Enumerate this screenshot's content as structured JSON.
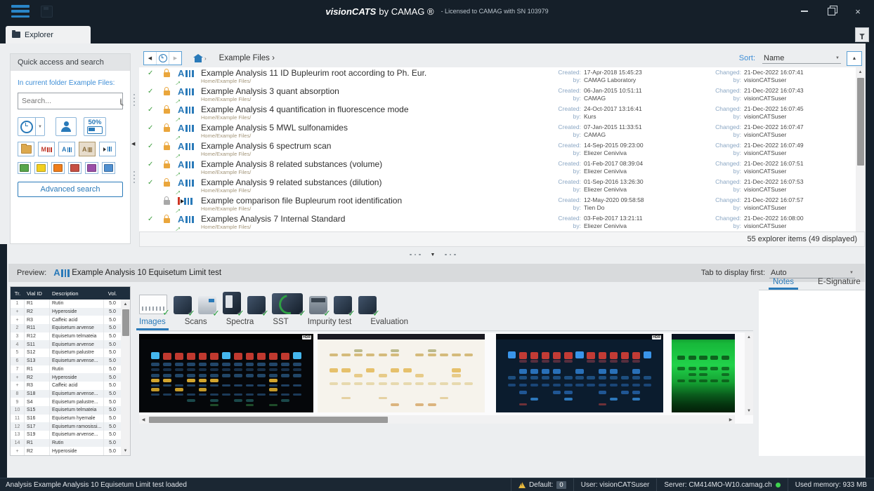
{
  "titlebar": {
    "product": "visionCATS",
    "by": "by CAMAG ®",
    "license": "-  Licensed to CAMAG with SN 103979",
    "minimize": "–",
    "restore": "",
    "close": "×"
  },
  "tabbar": {
    "explorer": "Explorer"
  },
  "quick": {
    "header": "Quick access and search",
    "context": "In current folder Example Files:",
    "search_placeholder": "Search...",
    "zoom": "50%",
    "advanced": "Advanced search",
    "letters": {
      "method": "M",
      "analysis": "A",
      "archive": "A"
    },
    "colors": [
      "#57a64a",
      "#f2cf1f",
      "#ef7d1a",
      "#c64f43",
      "#9b4fa8",
      "#4f8fd0"
    ]
  },
  "browser": {
    "breadcrumb": "Example Files ›",
    "sort_label": "Sort:",
    "sort_value": "Name",
    "labels": {
      "created": "Created:",
      "changed": "Changed:",
      "by": "by:"
    },
    "count": "55 explorer items (49 displayed)",
    "items": [
      {
        "title": "Example Analysis 11 ID Bupleurim root according to Ph. Eur.",
        "path": "Home/Example Files/",
        "created": "17-Apr-2018 15:45:23",
        "created_by": "CAMAG Laboratory",
        "changed": "21-Dec-2022 16:07:41",
        "changed_by": "visionCATSuser",
        "checked": true,
        "lock": "orange",
        "icon": "analysis"
      },
      {
        "title": "Example Analysis 3 quant absorption",
        "path": "Home/Example Files/",
        "created": "06-Jan-2015 10:51:11",
        "created_by": "CAMAG",
        "changed": "21-Dec-2022 16:07:43",
        "changed_by": "visionCATSuser",
        "checked": true,
        "lock": "orange",
        "icon": "analysis"
      },
      {
        "title": "Example Analysis 4 quantification in fluorescence mode",
        "path": "Home/Example Files/",
        "created": "24-Oct-2017 13:16:41",
        "created_by": "Kurs",
        "changed": "21-Dec-2022 16:07:45",
        "changed_by": "visionCATSuser",
        "checked": true,
        "lock": "orange",
        "icon": "analysis"
      },
      {
        "title": "Example Analysis 5 MWL sulfonamides",
        "path": "Home/Example Files/",
        "created": "07-Jan-2015 11:33:51",
        "created_by": "CAMAG",
        "changed": "21-Dec-2022 16:07:47",
        "changed_by": "visionCATSuser",
        "checked": true,
        "lock": "orange",
        "icon": "analysis"
      },
      {
        "title": "Example Analysis 6 spectrum scan",
        "path": "Home/Example Files/",
        "created": "14-Sep-2015 09:23:00",
        "created_by": "Eliezer Ceniviva",
        "changed": "21-Dec-2022 16:07:49",
        "changed_by": "visionCATSuser",
        "checked": true,
        "lock": "orange",
        "icon": "analysis"
      },
      {
        "title": "Example Analysis 8 related substances (volume)",
        "path": "Home/Example Files/",
        "created": "01-Feb-2017 08:39:04",
        "created_by": "Eliezer Ceniviva",
        "changed": "21-Dec-2022 16:07:51",
        "changed_by": "visionCATSuser",
        "checked": true,
        "lock": "orange",
        "icon": "analysis"
      },
      {
        "title": "Example Analysis 9 related substances (dilution)",
        "path": "Home/Example Files/",
        "created": "01-Sep-2016 13:26:30",
        "created_by": "Eliezer Ceniviva",
        "changed": "21-Dec-2022 16:07:53",
        "changed_by": "visionCATSuser",
        "checked": true,
        "lock": "orange",
        "icon": "analysis"
      },
      {
        "title": "Example comparison file Bupleurum root identification",
        "path": "Home/Example Files/",
        "created": "12-May-2020 09:58:58",
        "created_by": "Tien Do",
        "changed": "21-Dec-2022 16:07:57",
        "changed_by": "visionCATSuser",
        "checked": false,
        "lock": "gray",
        "icon": "comparison"
      },
      {
        "title": "Examples Analysis 7 Internal Standard",
        "path": "Home/Example Files/",
        "created": "03-Feb-2017 13:21:11",
        "created_by": "Eliezer Ceniviva",
        "changed": "21-Dec-2022 16:08:00",
        "changed_by": "visionCATSuser",
        "checked": true,
        "lock": "orange",
        "icon": "analysis"
      }
    ]
  },
  "preview": {
    "label": "Preview:",
    "title": "Example Analysis 10 Equisetum Limit test",
    "tab_first_label": "Tab to display first:",
    "tab_first_value": "Auto",
    "table": {
      "headers": [
        "Tr.",
        "Vial ID",
        "Description",
        "Vol."
      ],
      "rows": [
        [
          "1",
          "R1",
          "Rutin",
          "5.0"
        ],
        [
          "+",
          "R2",
          "Hyperoside",
          "5.0"
        ],
        [
          "+",
          "R3",
          "Caffeic acid",
          "5.0"
        ],
        [
          "2",
          "R11",
          "Equisetum arvense",
          "5.0"
        ],
        [
          "3",
          "R12",
          "Equisetum telmateia",
          "5.0"
        ],
        [
          "4",
          "S11",
          "Equisetum arvense",
          "5.0"
        ],
        [
          "5",
          "S12",
          "Equisetum palustre",
          "5.0"
        ],
        [
          "6",
          "S13",
          "Equisetum arvense...",
          "5.0"
        ],
        [
          "7",
          "R1",
          "Rutin",
          "5.0"
        ],
        [
          "+",
          "R2",
          "Hyperoside",
          "5.0"
        ],
        [
          "+",
          "R3",
          "Caffeic acid",
          "5.0"
        ],
        [
          "8",
          "S18",
          "Equisetum arvense...",
          "5.0"
        ],
        [
          "9",
          "S4",
          "Equisetum palustre...",
          "5.0"
        ],
        [
          "10",
          "S15",
          "Equisetum telmateia",
          "5.0"
        ],
        [
          "11",
          "S16",
          "Equisetum hyemale",
          "5.0"
        ],
        [
          "12",
          "S17",
          "Equisetum ramosissi...",
          "5.0"
        ],
        [
          "13",
          "S19",
          "Equisetum arvense...",
          "5.0"
        ],
        [
          "14",
          "R1",
          "Rutin",
          "5.0"
        ],
        [
          "+",
          "R2",
          "Hyperoside",
          "5.0"
        ]
      ]
    },
    "instruments": [
      "plate-layout",
      "sample-application",
      "plate-heater",
      "development-tower",
      "derivatizer",
      "visualizer",
      "immersion-device",
      "scanner",
      "documentation"
    ],
    "tabs": [
      "Images",
      "Scans",
      "Spectra",
      "SST",
      "Impurity test",
      "Evaluation"
    ],
    "active_tab": "Images",
    "side_tabs": [
      "Notes",
      "E-Signature"
    ],
    "active_side_tab": "Notes",
    "thumbnails": [
      {
        "name": "plate-image-366nm-derivatized",
        "badge": "HDR",
        "bg": "#05070a",
        "frame": "#000000",
        "lanes": 13,
        "bands": [
          {
            "y": 24,
            "h": 9,
            "c": "#c0392f",
            "skip": [
              0,
              6,
              12
            ]
          },
          {
            "y": 23,
            "h": 9,
            "c": "#45b7ee",
            "only": [
              0,
              6,
              12
            ]
          },
          {
            "y": 37,
            "h": 4,
            "c": "#3a7ab8",
            "a": 0.55
          },
          {
            "y": 44,
            "h": 3,
            "c": "#356fa8",
            "a": 0.4
          },
          {
            "y": 51,
            "h": 4,
            "c": "#3e86c4",
            "a": 0.5
          },
          {
            "y": 57,
            "h": 5,
            "c": "#d2a52e",
            "only": [
              0,
              1,
              3,
              4,
              5,
              10
            ]
          },
          {
            "y": 64,
            "h": 3,
            "c": "#3a7ab8",
            "a": 0.5
          },
          {
            "y": 69,
            "h": 4,
            "c": "#c59a28",
            "only": [
              0,
              2,
              4,
              10
            ]
          },
          {
            "y": 76,
            "h": 3,
            "c": "#3a7ab8",
            "a": 0.45
          },
          {
            "y": 83,
            "h": 4,
            "c": "#2f8a8a",
            "a": 0.5,
            "only": [
              3,
              5,
              7,
              8,
              11
            ]
          },
          {
            "y": 89,
            "h": 3,
            "c": "#3fa050",
            "a": 0.45,
            "only": [
              5,
              8,
              10
            ]
          }
        ]
      },
      {
        "name": "plate-image-white-light",
        "badge": "",
        "bg": "#f6f3ec",
        "frame": "#1a1a22",
        "lanes": 12,
        "bands": [
          {
            "y": 20,
            "h": 3,
            "c": "#8a8a40",
            "a": 0.55,
            "only": [
              2,
              5,
              8
            ]
          },
          {
            "y": 25,
            "h": 4,
            "c": "#c9a855",
            "a": 0.75,
            "skip": [
              6
            ]
          },
          {
            "y": 44,
            "h": 5,
            "c": "#e2b44c",
            "a": 0.8,
            "only": [
              0,
              1,
              3,
              5,
              6,
              10
            ]
          },
          {
            "y": 51,
            "h": 4,
            "c": "#ddb048",
            "a": 0.6,
            "only": [
              2,
              4,
              7,
              10
            ]
          },
          {
            "y": 62,
            "h": 3,
            "c": "#d8c070",
            "a": 0.5
          },
          {
            "y": 80,
            "h": 3,
            "c": "#d0a84a",
            "a": 0.45,
            "only": [
              1,
              4,
              9
            ]
          },
          {
            "y": 88,
            "h": 4,
            "c": "#c98a36",
            "a": 0.6,
            "only": [
              5,
              7,
              8
            ]
          }
        ]
      },
      {
        "name": "plate-image-366nm",
        "badge": "HDR",
        "bg": "#0b1c2e",
        "frame": "#050b12",
        "lanes": 13,
        "bands": [
          {
            "y": 23,
            "h": 9,
            "c": "#c23b35",
            "skip": [
              0,
              6,
              12
            ]
          },
          {
            "y": 22,
            "h": 9,
            "c": "#3a95ea",
            "only": [
              0,
              6,
              12
            ]
          },
          {
            "y": 33,
            "h": 4,
            "c": "#8a3a4a",
            "a": 0.6,
            "skip": [
              0,
              6,
              12
            ]
          },
          {
            "y": 45,
            "h": 6,
            "c": "#2f7fd0",
            "a": 0.85,
            "only": [
              1,
              2,
              3,
              4,
              6,
              8,
              9,
              11
            ]
          },
          {
            "y": 54,
            "h": 4,
            "c": "#2f7fd0",
            "a": 0.5
          },
          {
            "y": 63,
            "h": 4,
            "c": "#2a6fc0",
            "a": 0.5
          },
          {
            "y": 72,
            "h": 5,
            "c": "#2a6fc0",
            "a": 0.7,
            "only": [
              1,
              4,
              5,
              8,
              10,
              11
            ]
          },
          {
            "y": 81,
            "h": 4,
            "c": "#3a95ea",
            "a": 0.75,
            "only": [
              2,
              5,
              9,
              11
            ]
          },
          {
            "y": 88,
            "h": 3,
            "c": "#b04040",
            "a": 0.6,
            "only": [
              1,
              8
            ]
          }
        ]
      },
      {
        "name": "plate-image-254nm",
        "badge": "",
        "bg": "linear-gradient(180deg,#0f7d26 0%,#17b83a 12%,#21d24a 40%,#14a032 62%,#0a5a1c 78%,#05340f 90%,#031f08 100%)",
        "frame": "#0a1420",
        "lanes": 5,
        "bands": [
          {
            "y": 28,
            "h": 5,
            "c": "#0a4a14",
            "a": 0.8
          },
          {
            "y": 42,
            "h": 4,
            "c": "#0a4a14",
            "a": 0.7
          },
          {
            "y": 50,
            "h": 4,
            "c": "#083e10",
            "a": 0.6,
            "only": [
              1,
              2,
              4
            ]
          },
          {
            "y": 58,
            "h": 4,
            "c": "#0a4a14",
            "a": 0.7
          }
        ]
      }
    ]
  },
  "status": {
    "left": "Analysis Example Analysis 10 Equisetum Limit test loaded",
    "default_label": "Default:",
    "default_value": "0",
    "user": "User: visionCATSuser",
    "server": "Server: CM414MO-W10.camag.ch",
    "memory": "Used memory: 933 MB"
  }
}
